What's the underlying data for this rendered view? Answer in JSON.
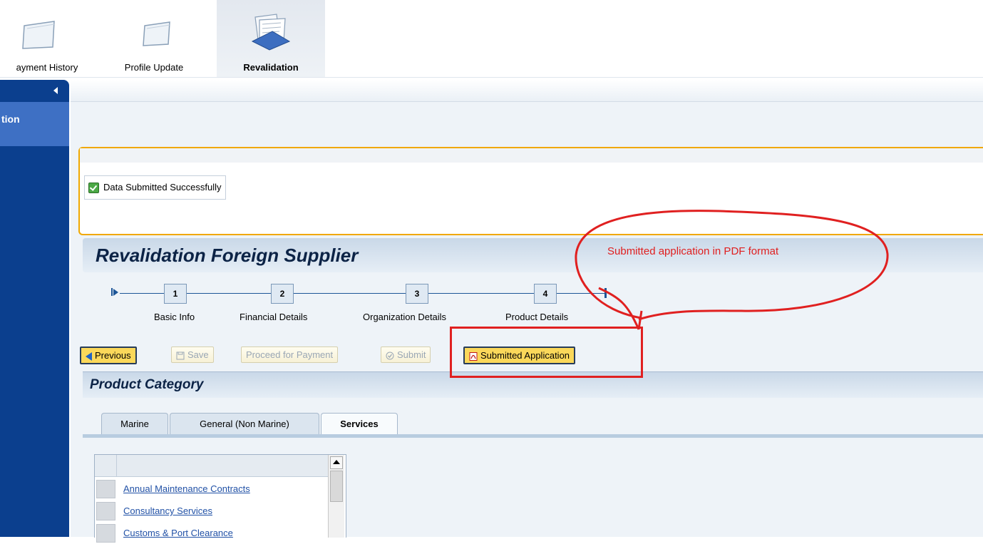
{
  "topnav": {
    "items": [
      {
        "label": "ayment History",
        "icon": "folder-icon",
        "active": false
      },
      {
        "label": "Profile Update",
        "icon": "folder-icon",
        "active": false
      },
      {
        "label": "Revalidation",
        "icon": "documents-icon",
        "active": true
      }
    ]
  },
  "sidebar": {
    "collapse_icon": "chevron-left-icon",
    "item_label": "tion"
  },
  "message": {
    "text": "Data Submitted Successfully",
    "icon": "checkbox-checked-icon",
    "border_color": "#f0a800"
  },
  "page": {
    "title": "Revalidation Foreign Supplier"
  },
  "roadmap": {
    "steps": [
      {
        "number": "1",
        "label": "Basic Info"
      },
      {
        "number": "2",
        "label": "Financial Details"
      },
      {
        "number": "3",
        "label": "Organization Details"
      },
      {
        "number": "4",
        "label": "Product Details"
      }
    ]
  },
  "toolbar": {
    "previous": "Previous",
    "save": "Save",
    "proceed": "Proceed for Payment",
    "submit": "Submit",
    "submitted_application": "Submitted Application"
  },
  "section": {
    "title": "Product Category"
  },
  "tabs": [
    {
      "label": "Marine",
      "active": false
    },
    {
      "label": "General (Non Marine)",
      "active": false
    },
    {
      "label": "Services",
      "active": true
    }
  ],
  "table": {
    "rows": [
      "Annual Maintenance Contracts",
      "Consultancy Services",
      "Customs & Port Clearance"
    ]
  },
  "annotation": {
    "callout_text": "Submitted application in PDF format",
    "color": "#e02020"
  }
}
